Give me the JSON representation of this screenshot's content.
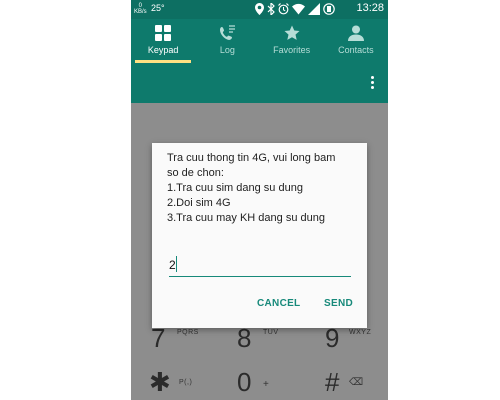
{
  "status_bar": {
    "speed_value": "0",
    "speed_unit": "KB/s",
    "temperature": "25°",
    "time": "13:28"
  },
  "tabs": [
    {
      "label": "Keypad",
      "icon": "keypad-icon",
      "active": true
    },
    {
      "label": "Log",
      "icon": "call-log-icon",
      "active": false
    },
    {
      "label": "Favorites",
      "icon": "star-icon",
      "active": false
    },
    {
      "label": "Contacts",
      "icon": "person-icon",
      "active": false
    }
  ],
  "keypad": {
    "row3": [
      {
        "digit": "7",
        "letters": "PQRS"
      },
      {
        "digit": "8",
        "letters": "TUV"
      },
      {
        "digit": "9",
        "letters": "WXYZ"
      }
    ],
    "row4": [
      {
        "digit": "✱",
        "letters": "P(,)"
      },
      {
        "digit": "0",
        "letters": "+"
      },
      {
        "digit": "#",
        "letters": "⌫"
      }
    ]
  },
  "dialog": {
    "lines": [
      "Tra cuu thong tin 4G, vui long bam",
      "so de chon:",
      "1.Tra cuu sim dang su dung",
      "2.Doi sim 4G",
      "3.Tra cuu may KH dang su dung"
    ],
    "input_value": "2",
    "cancel_label": "CANCEL",
    "send_label": "SEND"
  },
  "colors": {
    "app_bar": "#0e7a6c",
    "accent": "#17897a",
    "tab_indicator": "#ffe082"
  }
}
